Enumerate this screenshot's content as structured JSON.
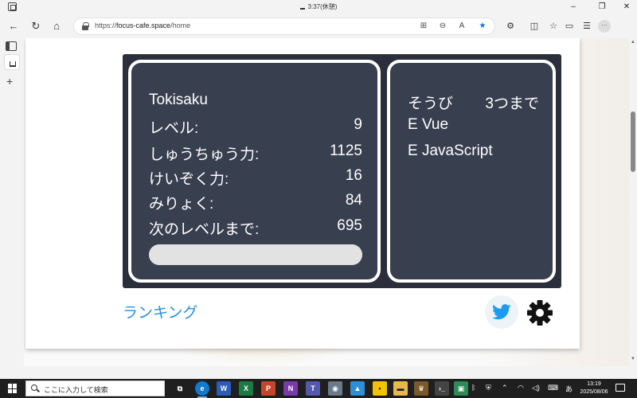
{
  "window": {
    "title": "3:37(休憩)"
  },
  "browser": {
    "url_scheme": "https://",
    "url_host": "focus-cafe.space",
    "url_path": "/home"
  },
  "player": {
    "name": "Tokisaku",
    "stats": [
      {
        "label": "レベル:",
        "value": "9"
      },
      {
        "label": "しゅうちゅう力:",
        "value": "1125"
      },
      {
        "label": "けいぞく力:",
        "value": "16"
      },
      {
        "label": "みりょく:",
        "value": "84"
      },
      {
        "label": "次のレベルまで:",
        "value": "695"
      }
    ],
    "progress": 1.0
  },
  "equipment": {
    "header": "そうび",
    "limit": "3つまで",
    "items": [
      "E  Vue",
      "E  JavaScript"
    ]
  },
  "links": {
    "ranking": "ランキング"
  },
  "taskbar": {
    "search_placeholder": "ここに入力して検索",
    "time": "13:19",
    "date": "2025/08/06",
    "ime": "あ"
  },
  "colors": {
    "panel_bg": "#383f4f",
    "outer_bg": "#2b2f3b",
    "link": "#2a8fd6",
    "twitter": "#1d9bf0"
  }
}
